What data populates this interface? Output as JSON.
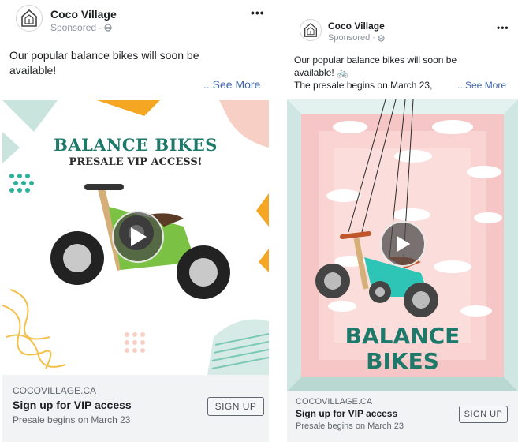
{
  "posts": [
    {
      "brand": "Coco Village",
      "sponsored": "Sponsored",
      "more_icon": "•••",
      "copy_line1": "Our popular balance bikes will soon be",
      "copy_line2": "available!",
      "copy_line3": "",
      "see_more": "...See More",
      "media": {
        "headline": "BALANCE BIKES",
        "subhead": "PRESALE VIP ACCESS!",
        "bike_color": "#7bc143",
        "accent_colors": [
          "#f5a623",
          "#2bb39a",
          "#f8cfc4",
          "#c9e3dd"
        ]
      },
      "footer": {
        "domain": "COCOVILLAGE.CA",
        "title": "Sign up for VIP access",
        "description": "Presale begins on March 23",
        "button": "SIGN UP"
      }
    },
    {
      "brand": "Coco Village",
      "sponsored": "Sponsored",
      "more_icon": "•••",
      "copy_line1": "Our popular balance bikes will soon be",
      "copy_line2": "available! 🚲",
      "copy_line3": "The presale begins on March 23,",
      "see_more": "...See More",
      "media": {
        "headline_line1": "BALANCE",
        "headline_line2": "BIKES",
        "bike_color": "#2ec4b6",
        "background_color": "#f6c6c6"
      },
      "footer": {
        "domain": "COCOVILLAGE.CA",
        "title": "Sign up for VIP access",
        "description": "Presale begins on March 23",
        "button": "SIGN UP"
      }
    }
  ]
}
